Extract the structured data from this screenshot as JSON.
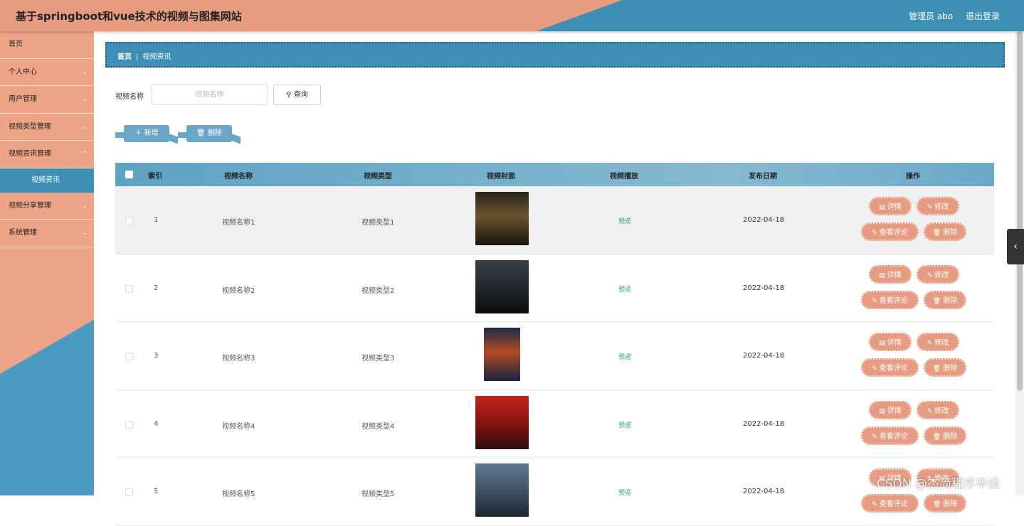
{
  "header": {
    "title": "基于springboot和vue技术的视频与图集网站",
    "user": "管理员 abo",
    "logout": "退出登录"
  },
  "sidebar": {
    "items": [
      {
        "label": "首页",
        "chevron": false
      },
      {
        "label": "个人中心",
        "chevron": true
      },
      {
        "label": "用户管理",
        "chevron": true
      },
      {
        "label": "视频类型管理",
        "chevron": true
      },
      {
        "label": "视频资讯管理",
        "chevron": true
      }
    ],
    "sub_item": "视频资讯",
    "items_after": [
      {
        "label": "视频分享管理",
        "chevron": true
      },
      {
        "label": "系统管理",
        "chevron": true
      }
    ]
  },
  "breadcrumb": {
    "home": "首页",
    "current": "视频资讯"
  },
  "search": {
    "label": "视频名称",
    "placeholder": "视频名称",
    "button": "查询"
  },
  "actions": {
    "add": "新增",
    "delete": "删除"
  },
  "table": {
    "headers": [
      "索引",
      "视频名称",
      "视频类型",
      "视频封面",
      "视频播放",
      "发布日期",
      "操作"
    ],
    "row_buttons": {
      "detail": "详情",
      "edit": "修改",
      "comments": "查看评论",
      "delete": "删除"
    },
    "rows": [
      {
        "index": "1",
        "name": "视频名称1",
        "type": "视频类型1",
        "play": "预览",
        "date": "2022-04-18",
        "cover": "poster-dark-gold"
      },
      {
        "index": "2",
        "name": "视频名称2",
        "type": "视频类型2",
        "play": "预览",
        "date": "2022-04-18",
        "cover": "poster-dark-grey"
      },
      {
        "index": "3",
        "name": "视频名称3",
        "type": "视频类型3",
        "play": "预览",
        "date": "2022-04-18",
        "cover": "poster-blue-fire"
      },
      {
        "index": "4",
        "name": "视频名称4",
        "type": "视频类型4",
        "play": "预览",
        "date": "2022-04-18",
        "cover": "poster-red"
      },
      {
        "index": "5",
        "name": "视频名称5",
        "type": "视频类型5",
        "play": "预览",
        "date": "2022-04-18",
        "cover": "poster-sky"
      }
    ]
  },
  "watermark": "CSDN @杰简程序毕设",
  "colors": {
    "primary": "#3f8eb5",
    "accent": "#e79c80",
    "preview": "#2a9d8f"
  }
}
